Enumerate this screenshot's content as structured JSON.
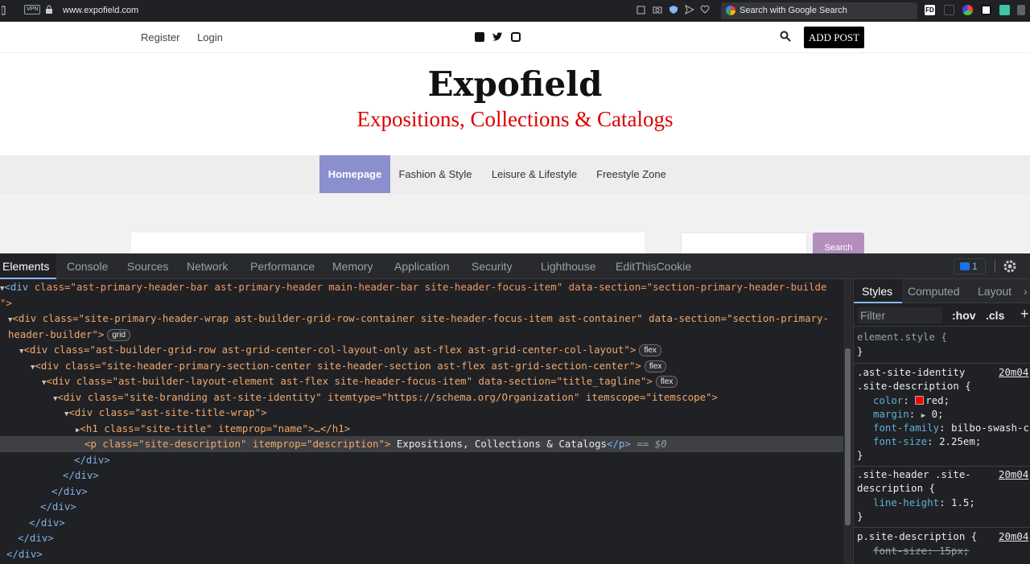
{
  "browser": {
    "url": "www.expofield.com",
    "vpn_label": "VPN",
    "search_placeholder": "Search with Google Search",
    "ext_label": "FD"
  },
  "site": {
    "topbar": {
      "register": "Register",
      "login": "Login",
      "add_post": "ADD POST"
    },
    "title": "Expofield",
    "tagline": "Expositions, Collections & Catalogs",
    "nav": [
      {
        "label": "Homepage",
        "active": true
      },
      {
        "label": "Fashion & Style",
        "active": false
      },
      {
        "label": "Leisure & Lifestyle",
        "active": false
      },
      {
        "label": "Freestyle Zone",
        "active": false
      }
    ],
    "search_button": "Search"
  },
  "devtools": {
    "tabs": [
      "Elements",
      "Console",
      "Sources",
      "Network",
      "Performance",
      "Memory",
      "Application",
      "Security",
      "Lighthouse",
      "EditThisCookie"
    ],
    "active_tab": "Elements",
    "issues_count": "1",
    "dom_lines": {
      "l1_tag": "<div",
      "l1_attrs": " class=\"ast-primary-header-bar ast-primary-header main-header-bar site-header-focus-item\" data-section=\"section-primary-header-builde",
      "l2": "\">",
      "l3a": "<div class=\"site-primary-header-wrap ast-builder-grid-row-container site-header-focus-item ast-container\" data-section=\"section-primary-",
      "l3b": "header-builder\">",
      "l3_badge": "grid",
      "l4": "<div class=\"ast-builder-grid-row ast-grid-center-col-layout-only ast-flex ast-grid-center-col-layout\">",
      "l4_badge": "flex",
      "l5": "<div class=\"site-header-primary-section-center site-header-section ast-flex ast-grid-section-center\">",
      "l5_badge": "flex",
      "l6": "<div class=\"ast-builder-layout-element ast-flex site-header-focus-item\" data-section=\"title_tagline\">",
      "l6_badge": "flex",
      "l7": "<div class=\"site-branding ast-site-identity\" itemtype=\"https://schema.org/Organization\" itemscope=\"itemscope\">",
      "l8": "<div class=\"ast-site-title-wrap\">",
      "l9": "<h1 class=\"site-title\" itemprop=\"name\">…</h1>",
      "l10_open": "<p class=\"site-description\" itemprop=\"description\">",
      "l10_text": " Expositions, Collections & Catalogs",
      "l10_close": "</p>",
      "l10_eq": " == $0",
      "close_div": "</div>"
    },
    "styles": {
      "tabs": [
        "Styles",
        "Computed",
        "Layout"
      ],
      "filter_placeholder": "Filter",
      "hov": ":hov",
      "cls": ".cls",
      "element_style": "element.style {",
      "close_brace": "}",
      "rule1_selector_a": ".ast-site-identity",
      "rule1_selector_b": ".site-description {",
      "rule1_source": "20m04",
      "rule1_props": [
        {
          "name": "color",
          "value": "red;"
        },
        {
          "name": "margin",
          "value": "0;"
        },
        {
          "name": "font-family",
          "value": "bilbo-swash-c"
        },
        {
          "name": "font-size",
          "value": "2.25em;"
        }
      ],
      "rule2_selector_a": ".site-header .site-",
      "rule2_selector_b": "description {",
      "rule2_source": "20m04",
      "rule2_prop": {
        "name": "line-height",
        "value": "1.5;"
      },
      "rule3_selector": "p.site-description {",
      "rule3_source": "20m04",
      "rule3_prop": {
        "name": "font-size",
        "value": "15px;"
      }
    }
  }
}
